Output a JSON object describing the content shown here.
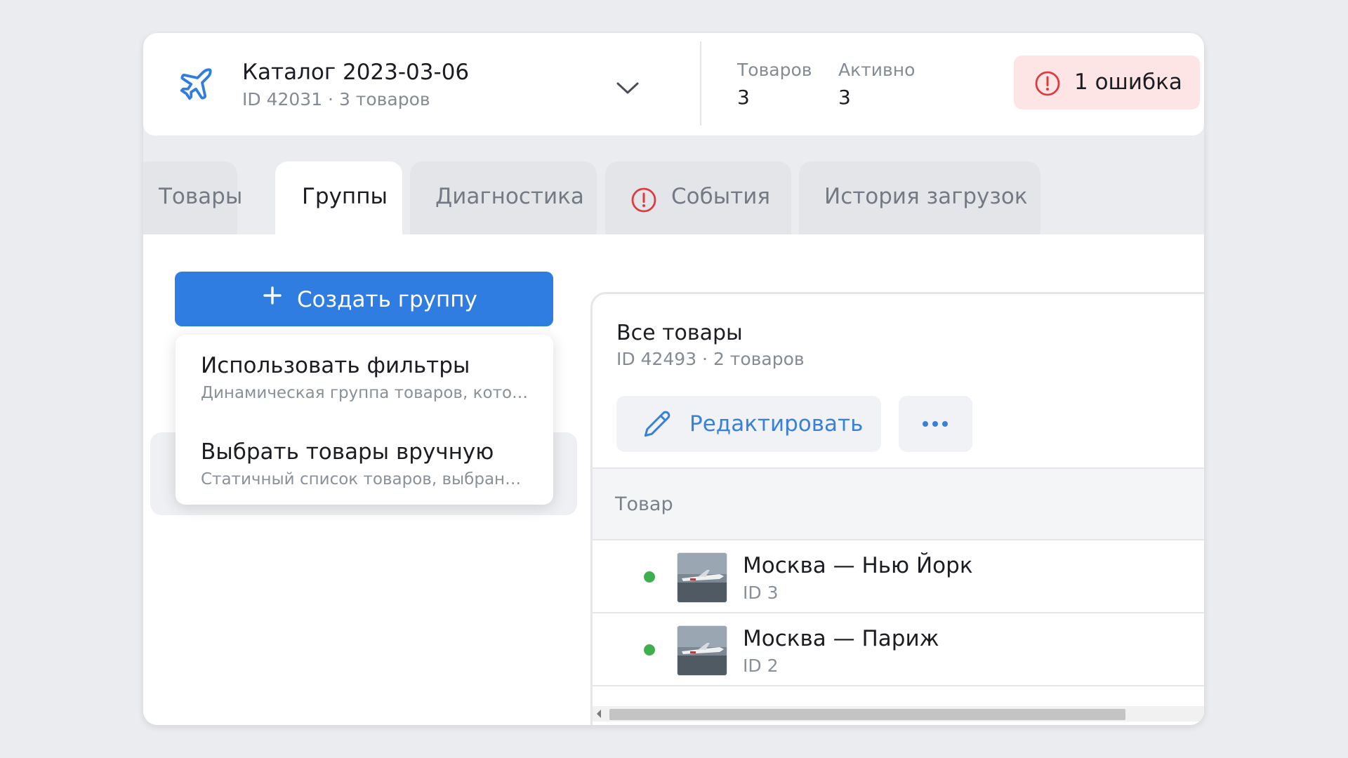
{
  "header": {
    "icon": "airplane-icon",
    "title": "Каталог 2023-03-06",
    "subtitle": "ID 42031 · 3 товаров",
    "stats": [
      {
        "label": "Товаров",
        "value": "3"
      },
      {
        "label": "Активно",
        "value": "3"
      }
    ],
    "error_badge": "1 ошибка"
  },
  "tabs": [
    {
      "label": "Товары",
      "active": false
    },
    {
      "label": "Группы",
      "active": true
    },
    {
      "label": "Диагностика",
      "active": false
    },
    {
      "label": "События",
      "active": false,
      "icon": "alert-icon"
    },
    {
      "label": "История загрузок",
      "active": false
    }
  ],
  "left": {
    "create_button": "Создать группу",
    "menu": [
      {
        "title": "Использовать фильтры",
        "description": "Динамическая группа товаров, котор..."
      },
      {
        "title": "Выбрать товары вручную",
        "description": "Статичный список товаров, выбранн..."
      }
    ]
  },
  "panel": {
    "title": "Все товары",
    "subtitle": "ID 42493 · 2 товаров",
    "edit_button": "Редактировать",
    "more_icon": "more-dots-icon",
    "column_header": "Товар",
    "rows": [
      {
        "name": "Москва — Нью Йорк",
        "id": "ID 3",
        "status": "active"
      },
      {
        "name": "Москва — Париж",
        "id": "ID 2",
        "status": "active"
      }
    ]
  },
  "colors": {
    "accent": "#2f7de1",
    "error_bg": "#fde5e6",
    "error_icon": "#e0393e",
    "active_dot": "#3fae4f"
  }
}
